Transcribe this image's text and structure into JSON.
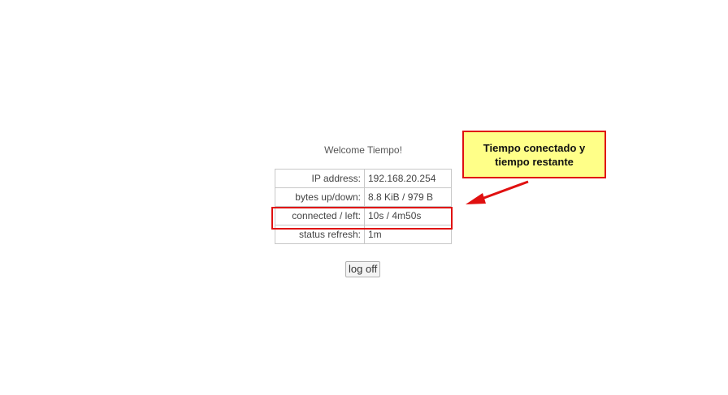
{
  "welcome": "Welcome Tiempo!",
  "status_rows": [
    {
      "label": "IP address:",
      "value": "192.168.20.254"
    },
    {
      "label": "bytes up/down:",
      "value": "8.8 KiB / 979 B"
    },
    {
      "label": "connected / left:",
      "value": "10s / 4m50s"
    },
    {
      "label": "status refresh:",
      "value": "1m"
    }
  ],
  "logoff_label": "log off",
  "annotation": {
    "text": "Tiempo conectado y tiempo restante",
    "border_color": "#e01010",
    "fill_color": "#ffff88"
  }
}
